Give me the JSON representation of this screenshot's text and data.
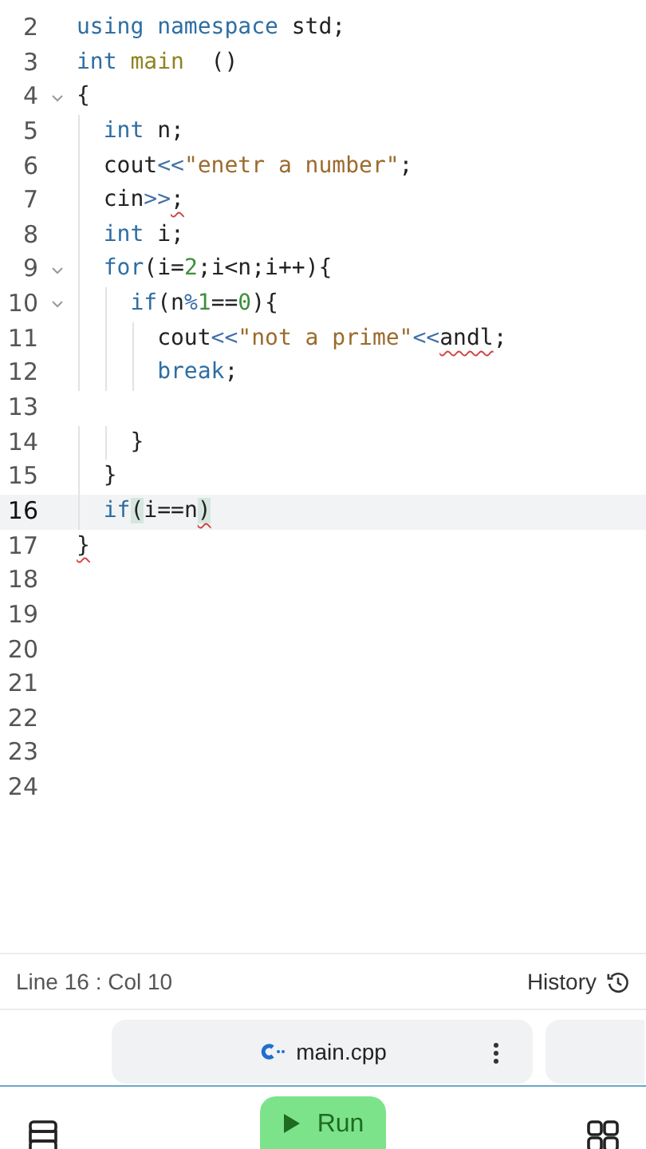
{
  "editor": {
    "lines": [
      {
        "number": "2",
        "foldable": false,
        "current": false,
        "tokens": [
          {
            "text": "using namespace",
            "kind": "keyword"
          },
          {
            "text": " std;",
            "kind": "plain"
          }
        ]
      },
      {
        "number": "3",
        "foldable": false,
        "current": false,
        "tokens": [
          {
            "text": "int",
            "kind": "keyword"
          },
          {
            "text": " main",
            "kind": "function"
          },
          {
            "text": "  ()",
            "kind": "plain"
          }
        ]
      },
      {
        "number": "4",
        "foldable": true,
        "current": false,
        "tokens": [
          {
            "text": "{",
            "kind": "plain"
          }
        ]
      },
      {
        "number": "5",
        "foldable": false,
        "current": false,
        "tokens": [
          {
            "text": "  int",
            "kind": "keyword"
          },
          {
            "text": " n;",
            "kind": "plain"
          }
        ]
      },
      {
        "number": "6",
        "foldable": false,
        "current": false,
        "tokens": [
          {
            "text": "  cout",
            "kind": "plain"
          },
          {
            "text": "<<",
            "kind": "operator"
          },
          {
            "text": "\"enetr a number\"",
            "kind": "string"
          },
          {
            "text": ";",
            "kind": "plain"
          }
        ]
      },
      {
        "number": "7",
        "foldable": false,
        "current": false,
        "tokens": [
          {
            "text": "  cin",
            "kind": "plain"
          },
          {
            "text": ">>",
            "kind": "operator"
          },
          {
            "text": ";",
            "kind": "error"
          }
        ]
      },
      {
        "number": "8",
        "foldable": false,
        "current": false,
        "tokens": [
          {
            "text": "  int",
            "kind": "keyword"
          },
          {
            "text": " i;",
            "kind": "plain"
          }
        ]
      },
      {
        "number": "9",
        "foldable": true,
        "current": false,
        "tokens": [
          {
            "text": "  for",
            "kind": "keyword"
          },
          {
            "text": "(i=",
            "kind": "plain"
          },
          {
            "text": "2",
            "kind": "number"
          },
          {
            "text": ";i<n;i++){",
            "kind": "plain"
          }
        ]
      },
      {
        "number": "10",
        "foldable": true,
        "current": false,
        "tokens": [
          {
            "text": "    if",
            "kind": "keyword"
          },
          {
            "text": "(n",
            "kind": "plain"
          },
          {
            "text": "%",
            "kind": "operator"
          },
          {
            "text": "1",
            "kind": "number"
          },
          {
            "text": "==",
            "kind": "plain"
          },
          {
            "text": "0",
            "kind": "number"
          },
          {
            "text": "){",
            "kind": "plain"
          }
        ]
      },
      {
        "number": "11",
        "foldable": false,
        "current": false,
        "tokens": [
          {
            "text": "      cout",
            "kind": "plain"
          },
          {
            "text": "<<",
            "kind": "operator"
          },
          {
            "text": "\"not a prime\"",
            "kind": "string"
          },
          {
            "text": "<<",
            "kind": "operator"
          },
          {
            "text": "andl",
            "kind": "error"
          },
          {
            "text": ";",
            "kind": "plain"
          }
        ]
      },
      {
        "number": "12",
        "foldable": false,
        "current": false,
        "tokens": [
          {
            "text": "      break",
            "kind": "keyword"
          },
          {
            "text": ";",
            "kind": "plain"
          }
        ]
      },
      {
        "number": "13",
        "foldable": false,
        "current": false
      },
      {
        "number": "14",
        "foldable": false,
        "current": false,
        "tokens": [
          {
            "text": "    }",
            "kind": "plain"
          }
        ]
      },
      {
        "number": "15",
        "foldable": false,
        "current": false,
        "tokens": [
          {
            "text": "  }",
            "kind": "plain"
          }
        ]
      },
      {
        "number": "16",
        "foldable": false,
        "current": true,
        "tokens": [
          {
            "text": "  if",
            "kind": "keyword"
          },
          {
            "text": "(",
            "kind": "match"
          },
          {
            "text": "i==n",
            "kind": "plain"
          },
          {
            "text": ")",
            "kind": "match-error"
          }
        ]
      },
      {
        "number": "17",
        "foldable": false,
        "current": false,
        "tokens": [
          {
            "text": "}",
            "kind": "error"
          }
        ]
      },
      {
        "number": "18",
        "foldable": false,
        "current": false
      },
      {
        "number": "19",
        "foldable": false,
        "current": false
      },
      {
        "number": "20",
        "foldable": false,
        "current": false
      },
      {
        "number": "21",
        "foldable": false,
        "current": false
      },
      {
        "number": "22",
        "foldable": false,
        "current": false
      },
      {
        "number": "23",
        "foldable": false,
        "current": false
      },
      {
        "number": "24",
        "foldable": false,
        "current": false
      }
    ]
  },
  "status_bar": {
    "position": "Line 16 : Col 10",
    "history": "History"
  },
  "file_tabs": [
    {
      "label": "main.cpp",
      "selected": true
    }
  ],
  "run_button": "Run"
}
